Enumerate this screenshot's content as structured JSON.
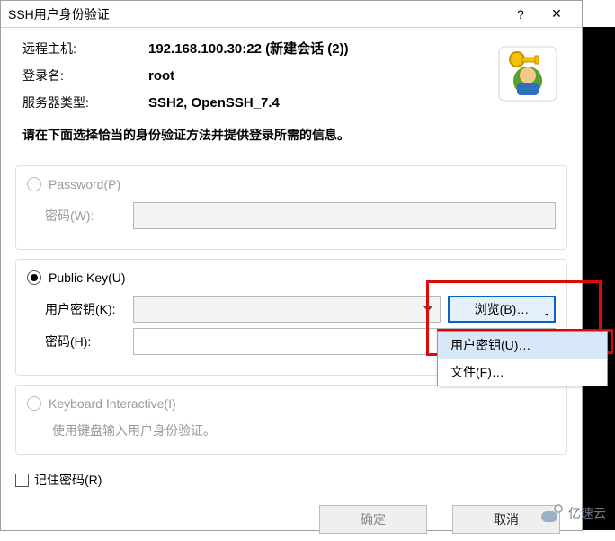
{
  "window": {
    "title": "SSH用户身份验证",
    "help": "?",
    "close": "✕"
  },
  "info": {
    "remote_host_label": "远程主机:",
    "remote_host_value": "192.168.100.30:22 (新建会话 (2))",
    "login_label": "登录名:",
    "login_value": "root",
    "server_type_label": "服务器类型:",
    "server_type_value": "SSH2, OpenSSH_7.4"
  },
  "instruction": "请在下面选择恰当的身份验证方法并提供登录所需的信息。",
  "password_group": {
    "radio_label": "Password(P)",
    "pw_label": "密码(W):",
    "pw_value": ""
  },
  "publickey_group": {
    "radio_label": "Public Key(U)",
    "userkey_label": "用户密钥(K):",
    "userkey_value": "",
    "browse_label": "浏览(B)…",
    "pw_label": "密码(H):",
    "pw_value": ""
  },
  "keyboard_group": {
    "radio_label": "Keyboard Interactive(I)",
    "desc": "使用键盘输入用户身份验证。"
  },
  "remember_label": "记住密码(R)",
  "buttons": {
    "ok": "确定",
    "cancel": "取消"
  },
  "dropdown": {
    "item1": "用户密钥(U)…",
    "item2": "文件(F)…"
  },
  "watermark": "亿速云"
}
